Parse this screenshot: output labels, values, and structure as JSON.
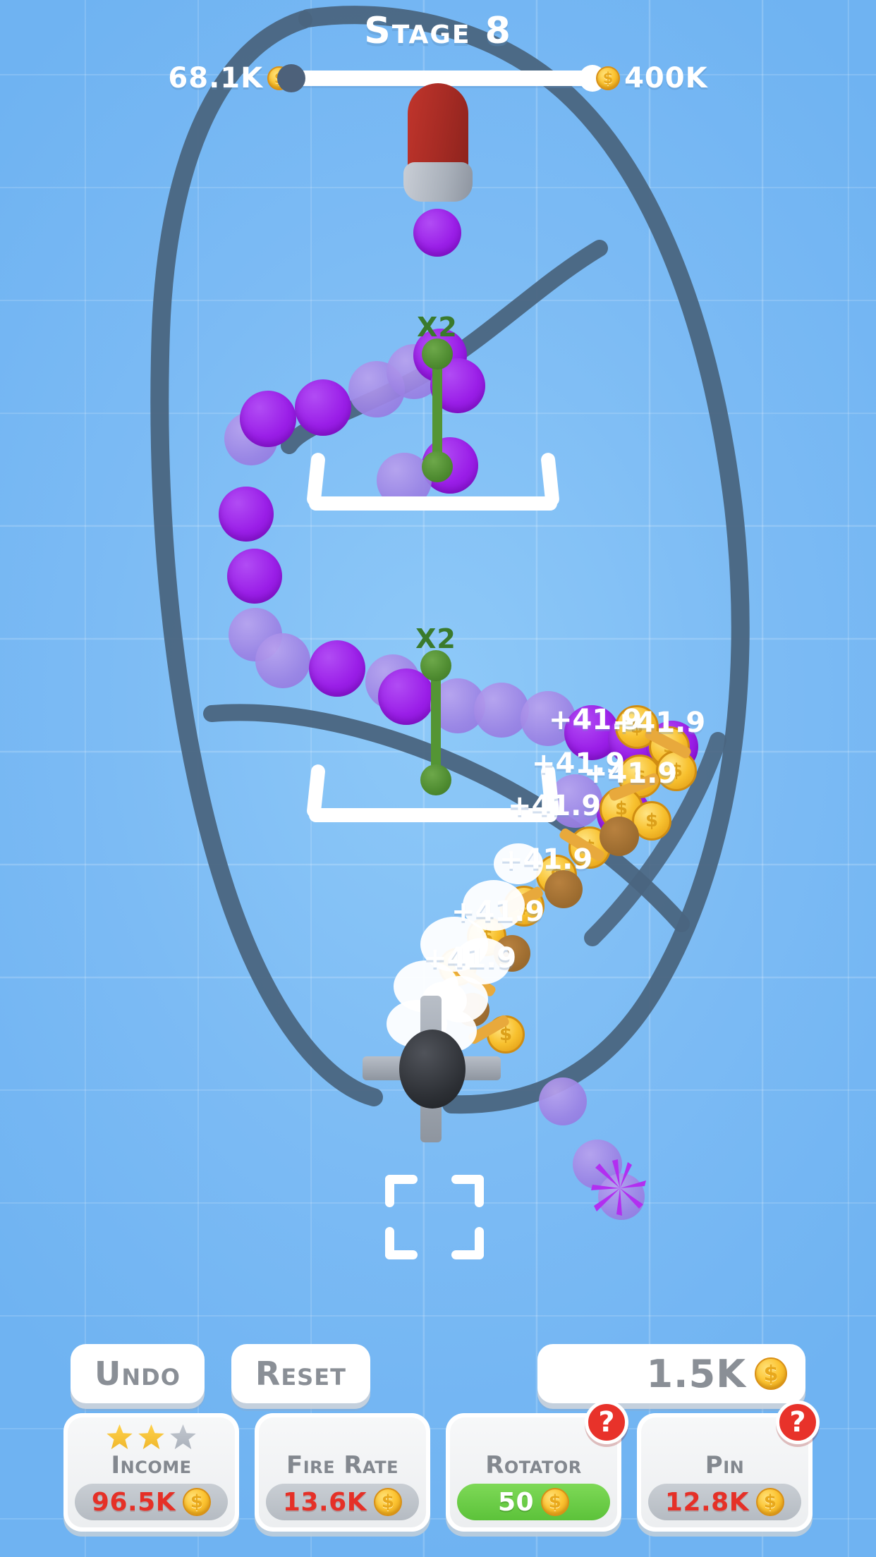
{
  "header": {
    "stage_title": "Stage 8",
    "progress_current": "68.1K",
    "progress_target": "400K",
    "coin_icon": "coin-icon"
  },
  "playfield": {
    "multipliers": [
      {
        "label": "X2"
      },
      {
        "label": "X2"
      }
    ],
    "score_popups": [
      {
        "text": "+41.9"
      },
      {
        "text": "+41.9"
      },
      {
        "text": "+41.9"
      },
      {
        "text": "+41.9"
      },
      {
        "text": "+41.9"
      },
      {
        "text": "+41.9"
      },
      {
        "text": "+41.9"
      },
      {
        "text": "+41.9"
      }
    ],
    "objects": {
      "cannon": "cannon-launcher",
      "rotator": "rotator-obstacle",
      "target_frame": "placement-target",
      "buckets": 2
    }
  },
  "controls": {
    "undo_label": "Undo",
    "reset_label": "Reset",
    "coin_balance": "1.5K"
  },
  "upgrades": [
    {
      "name": "Income",
      "price": "96.5K",
      "affordable": false,
      "stars_filled": 2,
      "stars_total": 3,
      "has_help_badge": false,
      "help_label": "?"
    },
    {
      "name": "Fire Rate",
      "price": "13.6K",
      "affordable": false,
      "stars_filled": 0,
      "stars_total": 0,
      "has_help_badge": false,
      "help_label": "?"
    },
    {
      "name": "Rotator",
      "price": "50",
      "affordable": true,
      "stars_filled": 0,
      "stars_total": 0,
      "has_help_badge": true,
      "help_label": "?"
    },
    {
      "name": "Pin",
      "price": "12.8K",
      "affordable": false,
      "stars_filled": 0,
      "stars_total": 0,
      "has_help_badge": true,
      "help_label": "?"
    }
  ],
  "colors": {
    "background": "#7fbdf5",
    "ink_stroke": "#4a6580",
    "ball_bright": "#9b1fe8",
    "ball_pale": "#9c82e4",
    "multiplier_green": "#549534",
    "affordable_green": "#5cc23a",
    "price_red": "#e53027",
    "badge_red": "#e8322a",
    "gold": "#f8c12f"
  }
}
